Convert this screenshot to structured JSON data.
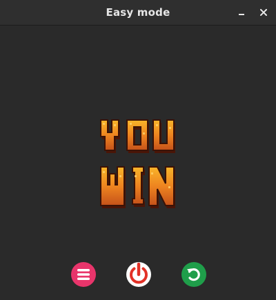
{
  "window": {
    "title": "Easy mode",
    "controls": {
      "minimize_icon": "minimize-icon",
      "close_icon": "close-icon"
    }
  },
  "game": {
    "result_art": {
      "line1": "YOU",
      "line2": "WIN",
      "fill_colors": [
        "#f7a21c",
        "#e8731b",
        "#b8420f"
      ],
      "outline_color": "#3a1206"
    },
    "buttons": [
      {
        "name": "menu",
        "icon": "hamburger-menu-icon",
        "color": "#e8356b"
      },
      {
        "name": "power",
        "icon": "power-icon",
        "color": "#e23127"
      },
      {
        "name": "restart",
        "icon": "restart-icon",
        "color": "#1f9e4a"
      }
    ]
  }
}
